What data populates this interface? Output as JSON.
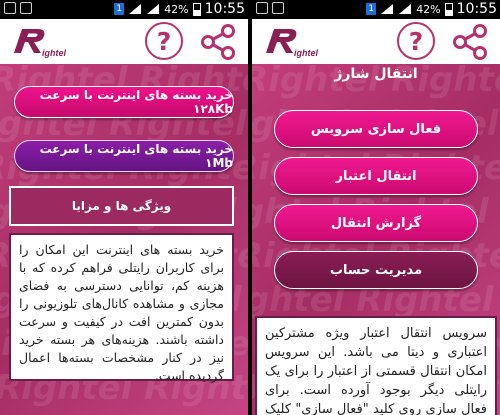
{
  "statusbar": {
    "battery_pct": "42%",
    "time": "10:55",
    "notif_count": "1"
  },
  "left": {
    "buttons": [
      {
        "label": "خرید بسته های اینترنت با سرعت ۱۲۸Kb"
      },
      {
        "label": "خرید بسته های اینترنت با سرعت ۱Mb"
      }
    ],
    "section_title": "ویژگی ها و مزایا",
    "description": "خرید بسته های اینترنت این امکان را برای کاربران رایتلی فراهم کرده که با هزینه کم، توانایی دسترسی به فضای مجازی و مشاهده کانال‌های تلوزیونی را بدون کمترین افت در کیفیت و سرعت داشته باشند. هزینه‌های هر بسته خرید نیز در کنار مشخصات بسته‌ها اعمال گردیده است."
  },
  "right": {
    "title": "انتقال شارژ",
    "buttons": [
      {
        "label": "فعال سازی سرویس"
      },
      {
        "label": "انتقال اعتبار"
      },
      {
        "label": "گزارش انتقال"
      },
      {
        "label": "مدیریت حساب"
      }
    ],
    "description": "سرویس انتقال اعتبار ویژه مشترکین اعتباری و دیتا می باشد. این سرویس امکان انتقال قسمتی از اعتبار را برای یک رایتلی دیگر بوجود آورده است. برای فعال سازی روی کلید \"فعال سازی\" کلیک نموده و بعد از"
  },
  "brand": {
    "name": "Rightel",
    "accent": "#b8306d",
    "hot": "#e8137f"
  },
  "icons": {
    "help": "question-mark-icon",
    "share": "share-icon",
    "logo": "rightel-logo"
  }
}
